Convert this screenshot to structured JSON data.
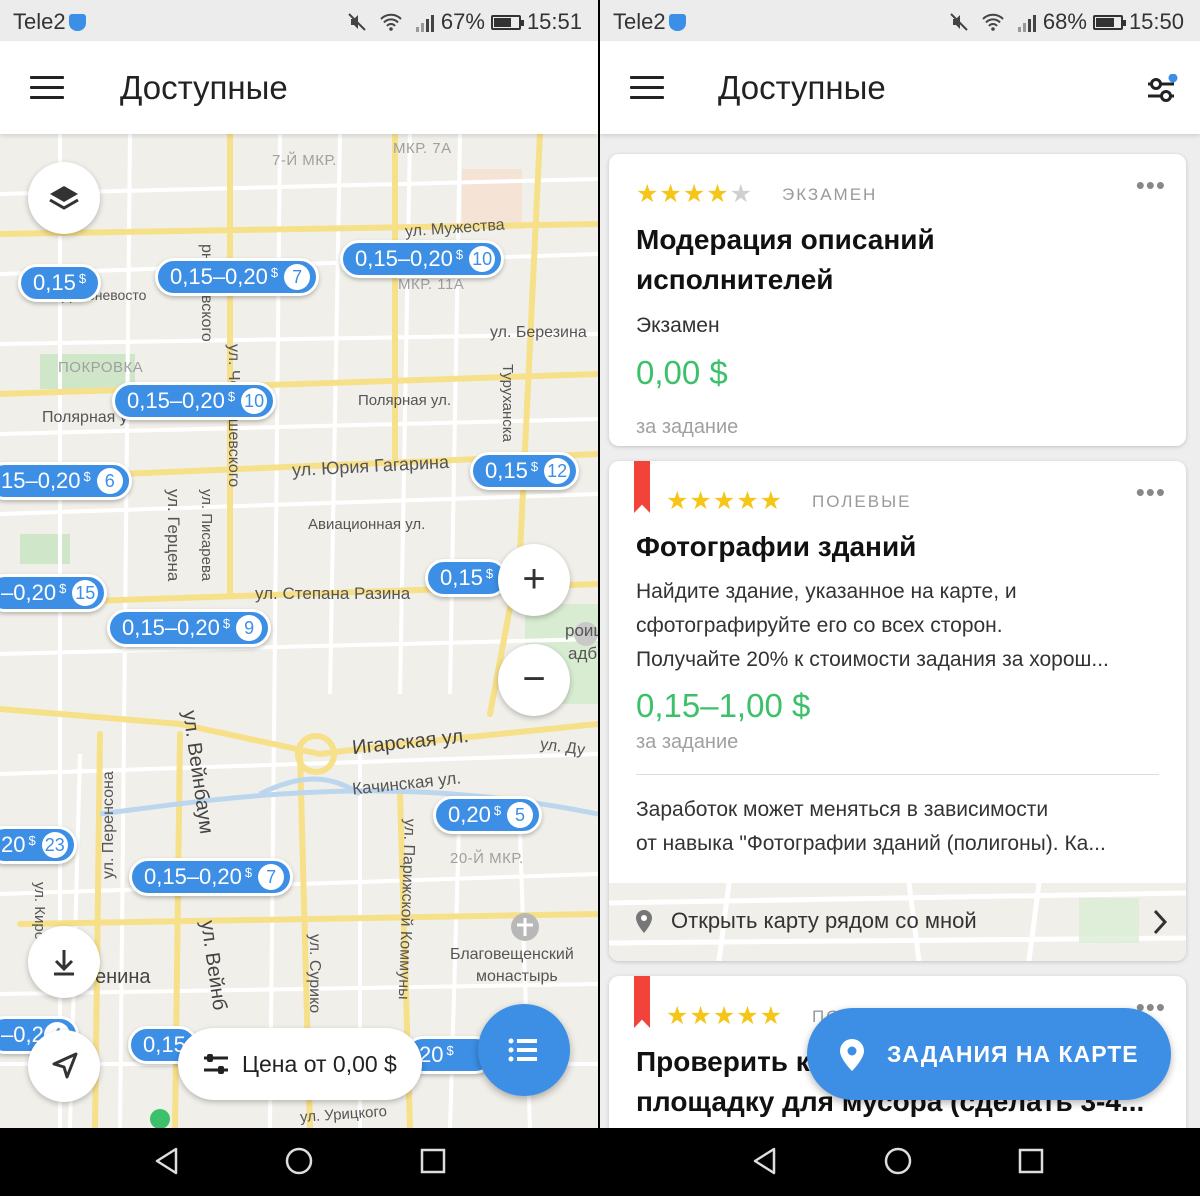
{
  "left": {
    "status": {
      "carrier": "Tele2",
      "battery": "67%",
      "time": "15:51"
    },
    "appbar": {
      "title": "Доступные"
    },
    "map_labels": {
      "mkr7": "7-Й МКР.",
      "mkr7a": "МКР. 7А",
      "muzhestva": "ул. Мужества",
      "mkr11a": "МКР. 11А",
      "dalnevost": "Дальневосто",
      "berezina": "ул. Березина",
      "pokrovka": "ПОКРОВКА",
      "polyarnaya_l": "Полярная у",
      "polyarnaya_r": "Полярная ул.",
      "gagarina": "ул. Юрия Гагарина",
      "aviacionnaya": "Авиационная ул.",
      "stepana_razina": "ул. Степана Разина",
      "igarskaya": "Игарская ул.",
      "kachinskaya": "Качинская ул.",
      "mkr20": "20-Й МКР.",
      "blagoveshch1": "Благовещенский",
      "blagoveshch2": "монастырь",
      "lenina": "енина",
      "uritskogo": "ул. Урицкого",
      "chernyshevskogo_top": "рнышевского",
      "chernyshevskogo_mid": "ул. Чернышевского",
      "gercena": "ул. Герцена",
      "pisareva": "ул. Писарева",
      "vejnbaum": "ул. Вейнбаум",
      "vejnbaum2": "ул. Вейнб",
      "perensona": "ул. Перенсона",
      "parizhskoj": "ул. Парижской Коммуны",
      "surikova": "ул. Сурико",
      "turuhanskaya": "Туруханска",
      "kirova": "ул. Киров",
      "dub": "ул. Ду",
      "stroi": "роиц",
      "ladb": "адб"
    },
    "pins": [
      {
        "price": "0,15",
        "currency": "$",
        "count": ""
      },
      {
        "price": "0,15–0,20",
        "currency": "$",
        "count": "7"
      },
      {
        "price": "0,15–0,20",
        "currency": "$",
        "count": "10"
      },
      {
        "price": "0,15–0,20",
        "currency": "$",
        "count": "10"
      },
      {
        "price": "15–0,20",
        "currency": "$",
        "count": "6"
      },
      {
        "price": "0,15",
        "currency": "$",
        "count": "12"
      },
      {
        "price": "–0,20",
        "currency": "$",
        "count": "15"
      },
      {
        "price": "0,15–0,20",
        "currency": "$",
        "count": "9"
      },
      {
        "price": "0,15",
        "currency": "$",
        "count": ""
      },
      {
        "price": "0,20",
        "currency": "$",
        "count": "5"
      },
      {
        "price": "20",
        "currency": "$",
        "count": "23"
      },
      {
        "price": "0,15–0,20",
        "currency": "$",
        "count": "7"
      },
      {
        "price": "–0,2",
        "currency": "",
        "count": "4"
      },
      {
        "price": "0,15",
        "currency": "",
        "count": ""
      },
      {
        "price": "20",
        "currency": "$",
        "count": ""
      }
    ],
    "controls": {
      "zoom_in": "+",
      "zoom_out": "−",
      "price_filter": "Цена от 0,00 $"
    }
  },
  "right": {
    "status": {
      "carrier": "Tele2",
      "battery": "68%",
      "time": "15:50"
    },
    "appbar": {
      "title": "Доступные"
    },
    "cards": [
      {
        "rating": 4.5,
        "stars": "★★★★",
        "half_star": "★",
        "tag": "ЭКЗАМЕН",
        "title_line1": "Модерация описаний",
        "title_line2": "исполнителей",
        "subtitle": "Экзамен",
        "price": "0,00 $",
        "per": "за задание"
      },
      {
        "rating": 5,
        "stars": "★★★★★",
        "tag": "ПОЛЕВЫЕ",
        "title_line1": "Фотографии зданий",
        "desc1": "Найдите здание, указанное на карте, и",
        "desc2": "сфотографируйте его со всех сторон.",
        "desc3": "Получайте 20% к стоимости задания за хорош...",
        "price": "0,15–1,00 $",
        "per": "за задание",
        "note1": "Заработок может меняться в зависимости",
        "note2": "от навыка \"Фотографии зданий (полигоны). Ка...",
        "map_link": "Открыть карту рядом со мной"
      },
      {
        "rating": 5,
        "stars": "★★★★★",
        "tag": "ПО",
        "title_line1": "Проверить к",
        "title_line2": "площадку для мусора (сделать 3-4..."
      }
    ],
    "fab": {
      "label": "ЗАДАНИЯ НА КАРТЕ"
    }
  },
  "colors": {
    "accent": "#3d8fe6",
    "price_green": "#3cc06a",
    "bookmark_red": "#f2433a",
    "star": "#f5c518"
  }
}
